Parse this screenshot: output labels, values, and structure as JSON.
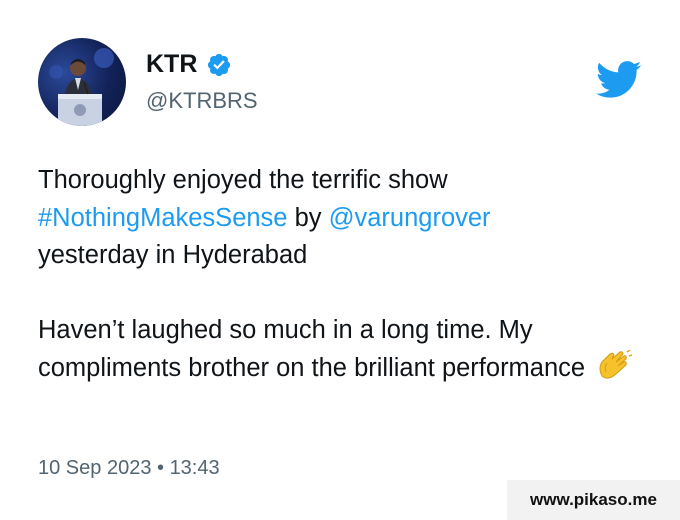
{
  "author": {
    "name": "KTR",
    "handle": "@KTRBRS",
    "verified_icon": "verified-badge-icon",
    "avatar": "profile-photo"
  },
  "brand": {
    "icon": "twitter-bird-icon",
    "color": "#1d9bf0"
  },
  "tweet": {
    "line1": "Thoroughly enjoyed the terrific show",
    "hashtag": "#NothingMakesSense",
    "by_text": " by ",
    "mention": "@varungrover",
    "line3": "yesterday in Hyderabad",
    "para2": "Haven’t laughed so much in a long time. My compliments brother on the brilliant performance",
    "emoji": "clapping-hands-icon"
  },
  "timestamp": {
    "date": "10 Sep 2023",
    "separator": " • ",
    "time": "13:43"
  },
  "watermark": "www.pikaso.me",
  "colors": {
    "link": "#1d9bf0",
    "text": "#0f1419",
    "muted": "#536471"
  }
}
